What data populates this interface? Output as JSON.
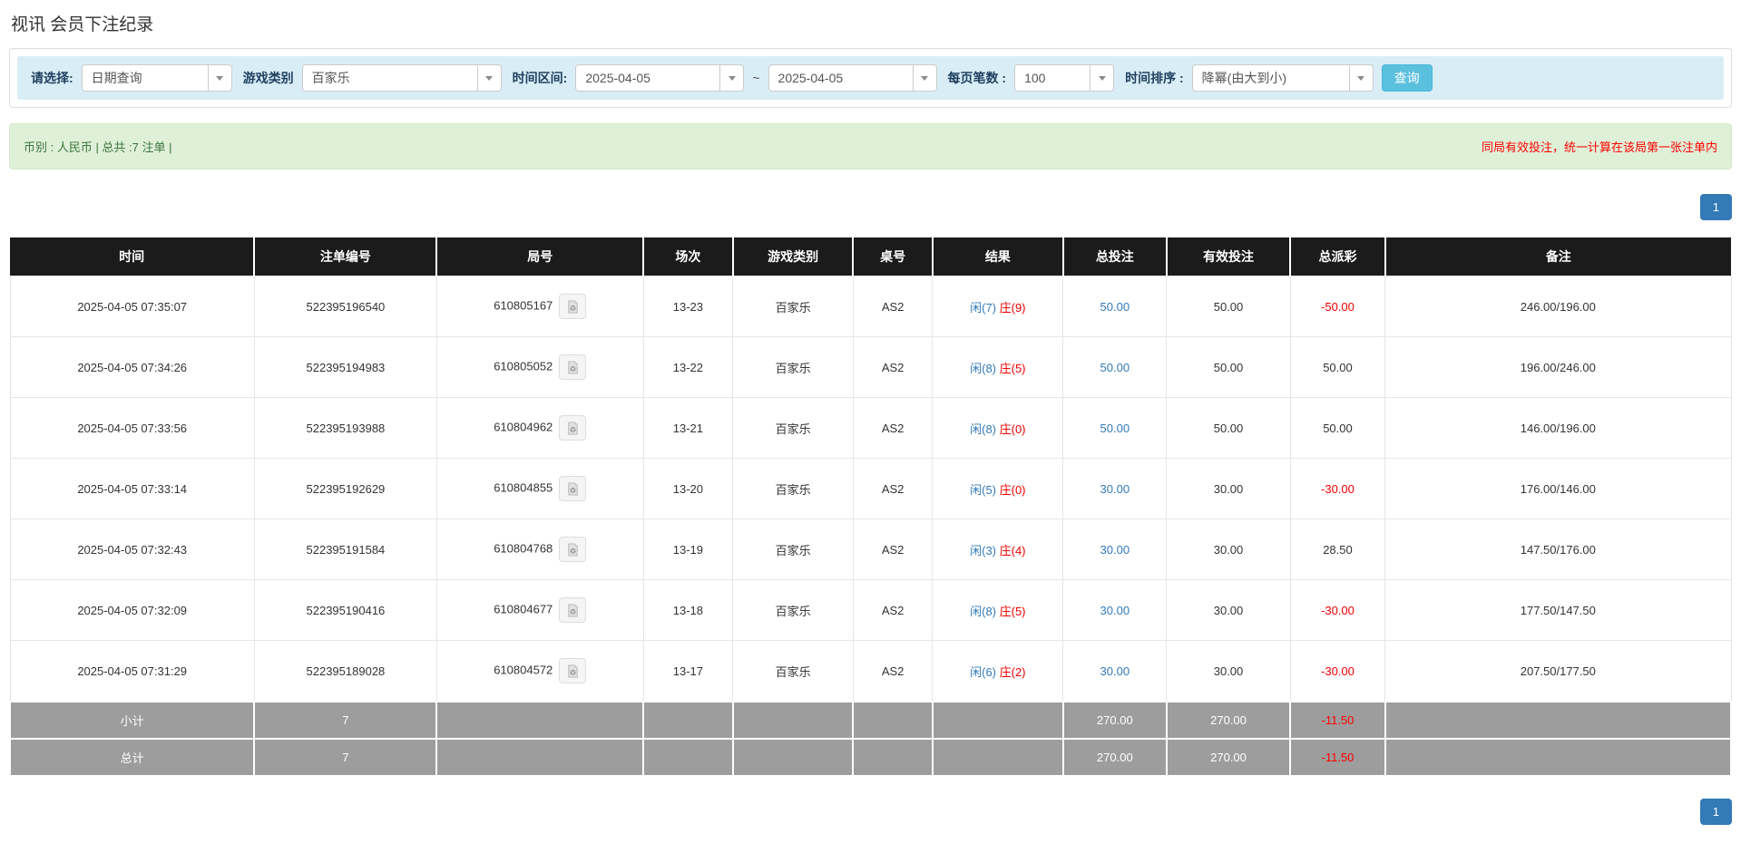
{
  "page": {
    "title": "视讯 会员下注纪录"
  },
  "colors": {
    "filter_bar_bg": "#d9edf7",
    "search_button_bg": "#5bc0de",
    "alert_bg": "#dff0d8",
    "alert_text_green": "#3c763d",
    "alert_note_red": "#ff0000",
    "table_header_bg": "#1b1b1b",
    "summary_row_bg": "#9d9d9d",
    "link_blue": "#337ab7",
    "negative_red": "#f00000"
  },
  "filters": {
    "select_label": "请选择:",
    "select_value": "日期查询",
    "game_label": "游戏类别",
    "game_value": "百家乐",
    "range_label": "时间区间:",
    "date_from": "2025-04-05",
    "range_separator": "~",
    "date_to": "2025-04-05",
    "per_page_label": "每页笔数 :",
    "per_page_value": "100",
    "sort_label": "时间排序 :",
    "sort_value": "降幂(由大到小)",
    "search_button": "查询"
  },
  "summary_bar": {
    "left_text": "币别 : 人民币 | 总共 :7 注单 |",
    "right_note": "同局有效投注，统一计算在该局第一张注单内"
  },
  "pagination": {
    "page": "1"
  },
  "table": {
    "columns": [
      "时间",
      "注单编号",
      "局号",
      "场次",
      "游戏类别",
      "桌号",
      "结果",
      "总投注",
      "有效投注",
      "总派彩",
      "备注"
    ],
    "rows": [
      {
        "time": "2025-04-05 07:35:07",
        "bet_no": "522395196540",
        "round_no": "610805167",
        "session": "13-23",
        "game_type": "百家乐",
        "table_no": "AS2",
        "result_player": "闲(7)",
        "result_banker": "庄(9)",
        "total_bet": "50.00",
        "valid_bet": "50.00",
        "payout": "-50.00",
        "remark": "246.00/196.00"
      },
      {
        "time": "2025-04-05 07:34:26",
        "bet_no": "522395194983",
        "round_no": "610805052",
        "session": "13-22",
        "game_type": "百家乐",
        "table_no": "AS2",
        "result_player": "闲(8)",
        "result_banker": "庄(5)",
        "total_bet": "50.00",
        "valid_bet": "50.00",
        "payout": "50.00",
        "remark": "196.00/246.00"
      },
      {
        "time": "2025-04-05 07:33:56",
        "bet_no": "522395193988",
        "round_no": "610804962",
        "session": "13-21",
        "game_type": "百家乐",
        "table_no": "AS2",
        "result_player": "闲(8)",
        "result_banker": "庄(0)",
        "total_bet": "50.00",
        "valid_bet": "50.00",
        "payout": "50.00",
        "remark": "146.00/196.00"
      },
      {
        "time": "2025-04-05 07:33:14",
        "bet_no": "522395192629",
        "round_no": "610804855",
        "session": "13-20",
        "game_type": "百家乐",
        "table_no": "AS2",
        "result_player": "闲(5)",
        "result_banker": "庄(0)",
        "total_bet": "30.00",
        "valid_bet": "30.00",
        "payout": "-30.00",
        "remark": "176.00/146.00"
      },
      {
        "time": "2025-04-05 07:32:43",
        "bet_no": "522395191584",
        "round_no": "610804768",
        "session": "13-19",
        "game_type": "百家乐",
        "table_no": "AS2",
        "result_player": "闲(3)",
        "result_banker": "庄(4)",
        "total_bet": "30.00",
        "valid_bet": "30.00",
        "payout": "28.50",
        "remark": "147.50/176.00"
      },
      {
        "time": "2025-04-05 07:32:09",
        "bet_no": "522395190416",
        "round_no": "610804677",
        "session": "13-18",
        "game_type": "百家乐",
        "table_no": "AS2",
        "result_player": "闲(8)",
        "result_banker": "庄(5)",
        "total_bet": "30.00",
        "valid_bet": "30.00",
        "payout": "-30.00",
        "remark": "177.50/147.50"
      },
      {
        "time": "2025-04-05 07:31:29",
        "bet_no": "522395189028",
        "round_no": "610804572",
        "session": "13-17",
        "game_type": "百家乐",
        "table_no": "AS2",
        "result_player": "闲(6)",
        "result_banker": "庄(2)",
        "total_bet": "30.00",
        "valid_bet": "30.00",
        "payout": "-30.00",
        "remark": "207.50/177.50"
      }
    ],
    "summary_rows": [
      {
        "label": "小计",
        "count": "7",
        "total_bet": "270.00",
        "valid_bet": "270.00",
        "payout": "-11.50"
      },
      {
        "label": "总计",
        "count": "7",
        "total_bet": "270.00",
        "valid_bet": "270.00",
        "payout": "-11.50"
      }
    ]
  }
}
